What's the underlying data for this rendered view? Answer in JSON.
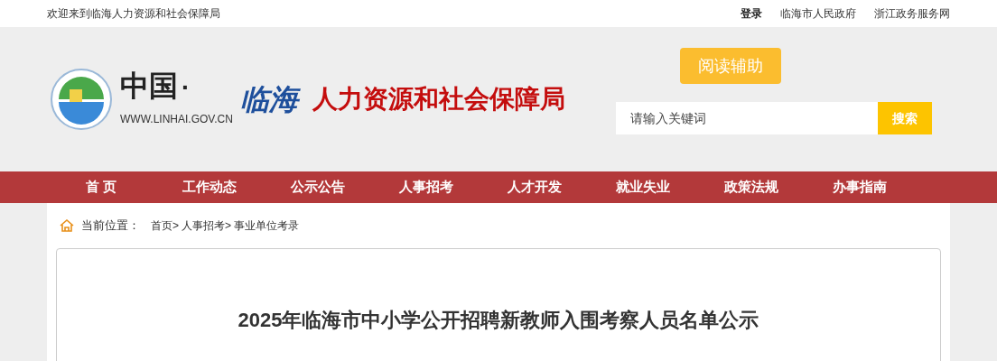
{
  "top_bar": {
    "welcome": "欢迎来到临海人力资源和社会保障局",
    "links": [
      "登录",
      "临海市人民政府",
      "浙江政务服务网"
    ]
  },
  "header": {
    "logo": {
      "brand": "中国",
      "dot": "·",
      "city": "临海",
      "url": "WWW.LINHAI.GOV.CN",
      "department": "人力资源和社会保障局"
    },
    "reading_aid": "阅读辅助",
    "search": {
      "placeholder": "请输入关键词",
      "button": "搜索"
    }
  },
  "nav": [
    "首 页",
    "工作动态",
    "公示公告",
    "人事招考",
    "人才开发",
    "就业失业",
    "政策法规",
    "办事指南"
  ],
  "breadcrumb": {
    "label": "当前位置：",
    "items": [
      "首页>",
      "人事招考>",
      "事业单位考录"
    ]
  },
  "article": {
    "title": "2025年临海市中小学公开招聘新教师入围考察人员名单公示"
  }
}
